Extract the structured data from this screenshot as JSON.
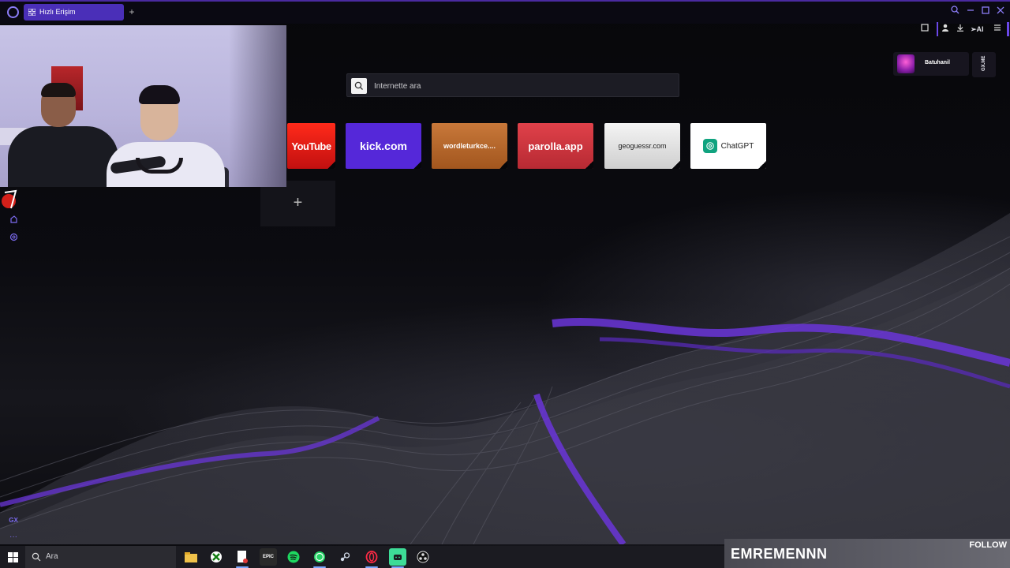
{
  "browser": {
    "tab": {
      "label": "Hızlı Erişim",
      "icon": "grid-icon"
    },
    "search_placeholder": "İnternette ara",
    "toolbar_ai_label": "AI"
  },
  "speed_dials": [
    {
      "label": "YouTube",
      "color": "#e0201a"
    },
    {
      "label": "kick.com",
      "color": "#5528d9"
    },
    {
      "label": "wordleturkce....",
      "color": "#b9662a"
    },
    {
      "label": "parolla.app",
      "color": "#d23a42"
    },
    {
      "label": "geoguessr.com",
      "color": "#e6e6e6"
    },
    {
      "label": "ChatGPT",
      "color": "#ffffff"
    }
  ],
  "add_dial_label": "+",
  "gx_profile": {
    "name": "Batuhanil",
    "badge": "GX.ME"
  },
  "sidebar": {
    "bottom_label": "GX"
  },
  "taskbar": {
    "search_label": "Ara",
    "apps": [
      "file-explorer",
      "xbox",
      "notepad",
      "epic-games",
      "spotify",
      "whatsapp",
      "steam",
      "opera-gx",
      "android-app",
      "obs"
    ],
    "epic_label": "EPIC"
  },
  "stream_overlay": {
    "name": "EMREMENNN",
    "follow_label": "FOLLOW"
  },
  "colors": {
    "accent": "#6b48e8",
    "tab": "#4a2fb8"
  }
}
